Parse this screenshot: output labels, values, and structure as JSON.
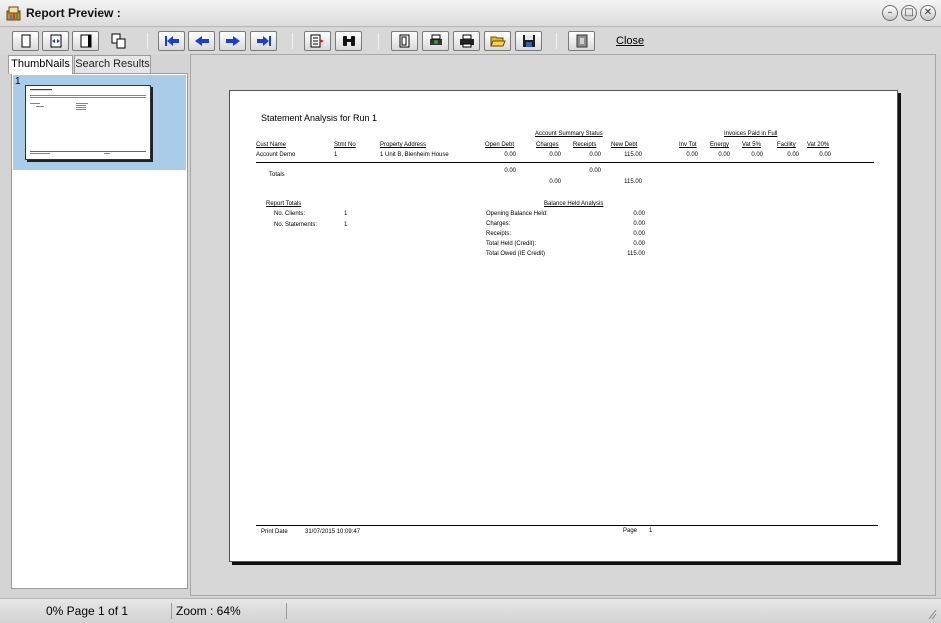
{
  "window": {
    "title": "Report Preview :",
    "minimize_glyph": "–",
    "maximize_glyph": "□",
    "close_glyph": "✕"
  },
  "toolbar": {
    "close_label": "Close"
  },
  "left_panel": {
    "tabs": [
      "ThumbNails",
      "Search Results"
    ],
    "active_tab": "ThumbNails",
    "thumbnail_number": "1"
  },
  "report": {
    "title": "Statement Analysis for Run 1",
    "group_headers": {
      "account_summary": "Account Summary Status",
      "invoices_paid": "Invoices Paid in Full"
    },
    "columns": [
      "Cust Name",
      "Stmt No",
      "Property Address",
      "Open Debt",
      "Charges",
      "Receipts",
      "New Debt",
      "Inv Tot",
      "Energy",
      "Vat 5%",
      "Facility",
      "Vat 20%"
    ],
    "row": [
      "Account Demo",
      "1",
      "1 Unit B, Blenheim House",
      "0.00",
      "0.00",
      "0.00",
      "115.00",
      "0.00",
      "0.00",
      "0.00",
      "0.00",
      "0.00"
    ],
    "totals": {
      "label": "Totals",
      "open_debt": "0.00",
      "receipts": "0.00",
      "charges": "0.00",
      "new_debt": "115.00"
    },
    "report_totals": {
      "header": "Report Totals",
      "clients_label": "No. Clients:",
      "clients_value": "1",
      "statements_label": "No. Statements:",
      "statements_value": "1"
    },
    "balance_held": {
      "header": "Balance Held Analysis",
      "items": [
        {
          "label": "Opening Balance Held:",
          "value": "0.00"
        },
        {
          "label": "Charges:",
          "value": "0.00"
        },
        {
          "label": "Receipts:",
          "value": "0.00"
        },
        {
          "label": "Total Held (Credit):",
          "value": "0.00"
        },
        {
          "label": "Total Owed (IE Credit)",
          "value": "115.00"
        }
      ]
    },
    "footer": {
      "print_date_label": "Print Date",
      "print_date_value": "31/07/2015 10:09:47",
      "page_label": "Page",
      "page_value": "1"
    }
  },
  "status": {
    "progress_page": "0% Page 1 of 1",
    "zoom": "Zoom : 64%"
  }
}
